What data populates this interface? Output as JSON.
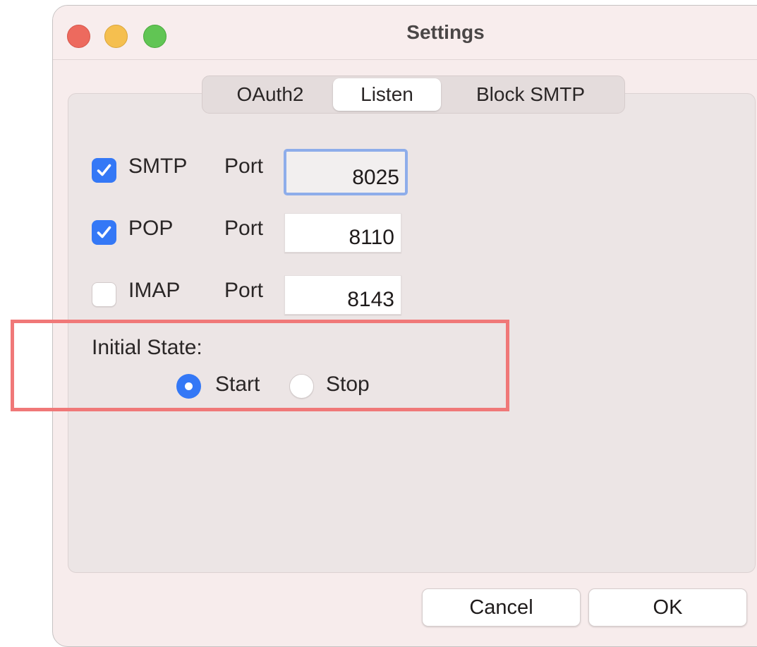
{
  "window": {
    "title": "Settings"
  },
  "tabs": [
    {
      "label": "OAuth2",
      "selected": false
    },
    {
      "label": "Listen",
      "selected": true
    },
    {
      "label": "Block SMTP",
      "selected": false
    }
  ],
  "listen": {
    "protocols": [
      {
        "name": "SMTP",
        "checked": true,
        "port_label": "Port",
        "port": "8025",
        "focused": true
      },
      {
        "name": "POP",
        "checked": true,
        "port_label": "Port",
        "port": "8110",
        "focused": false
      },
      {
        "name": "IMAP",
        "checked": false,
        "port_label": "Port",
        "port": "8143",
        "focused": false
      }
    ],
    "initial_state": {
      "label": "Initial State:",
      "options": [
        {
          "label": "Start",
          "selected": true
        },
        {
          "label": "Stop",
          "selected": false
        }
      ]
    }
  },
  "buttons": {
    "cancel": "Cancel",
    "ok": "OK"
  },
  "colors": {
    "accent": "#3478f6",
    "highlight_box": "#f07878",
    "traffic_close": "#ed6a5e",
    "traffic_minimize": "#f5bf4f",
    "traffic_maximize": "#61c554"
  },
  "icons": {
    "checkbox": "checkmark-icon",
    "radio": "radio-dot-icon"
  }
}
